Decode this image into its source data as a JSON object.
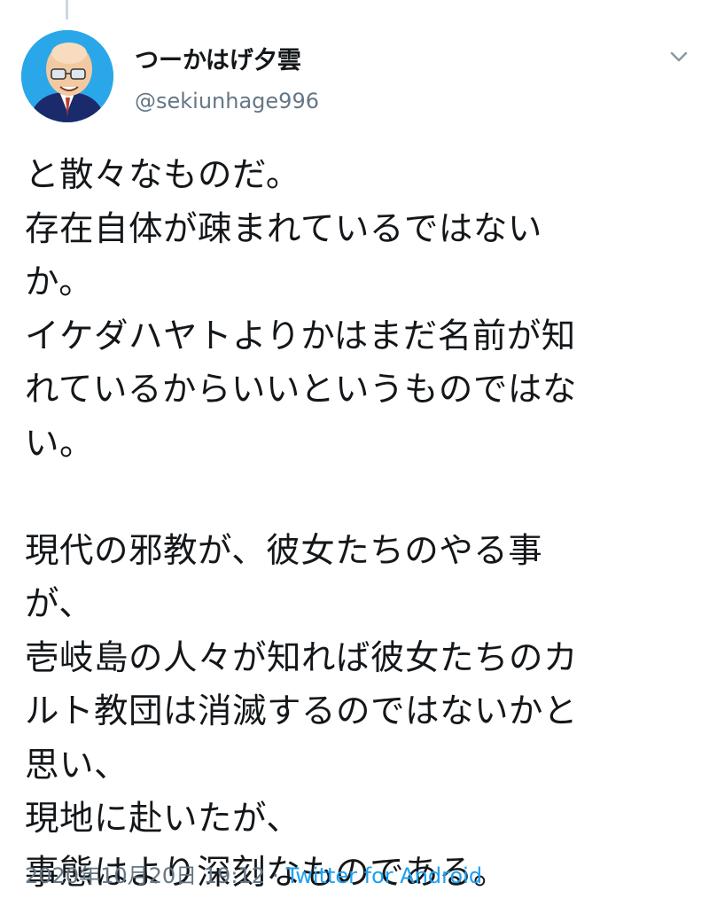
{
  "tweet": {
    "author": {
      "display_name": "つーかはげ夕雲",
      "handle": "@sekiunhage996"
    },
    "lines": [
      "と散々なものだ。",
      "存在自体が疎まれているではない",
      "か。",
      "イケダハヤトよりかはまだ名前が知",
      "れているからいいというものではな",
      "い。",
      "",
      "現代の邪教が、彼女たちのやる事",
      "が、",
      "壱岐島の人々が知れば彼女たちのカ",
      "ルト教団は消滅するのではないかと",
      "思い、",
      "現地に赴いたが、",
      "事態はより深刻なものである。"
    ],
    "timestamp": "2020年10月20日 19:12",
    "separator": "·",
    "client": "Twitter for Android"
  },
  "icons": {
    "avatar": "avatar-illustration",
    "menu": "chevron-down-icon"
  },
  "colors": {
    "name": "#14171a",
    "secondary": "#657786",
    "link": "#1da1f2",
    "thread_line": "#ccd6dd"
  }
}
